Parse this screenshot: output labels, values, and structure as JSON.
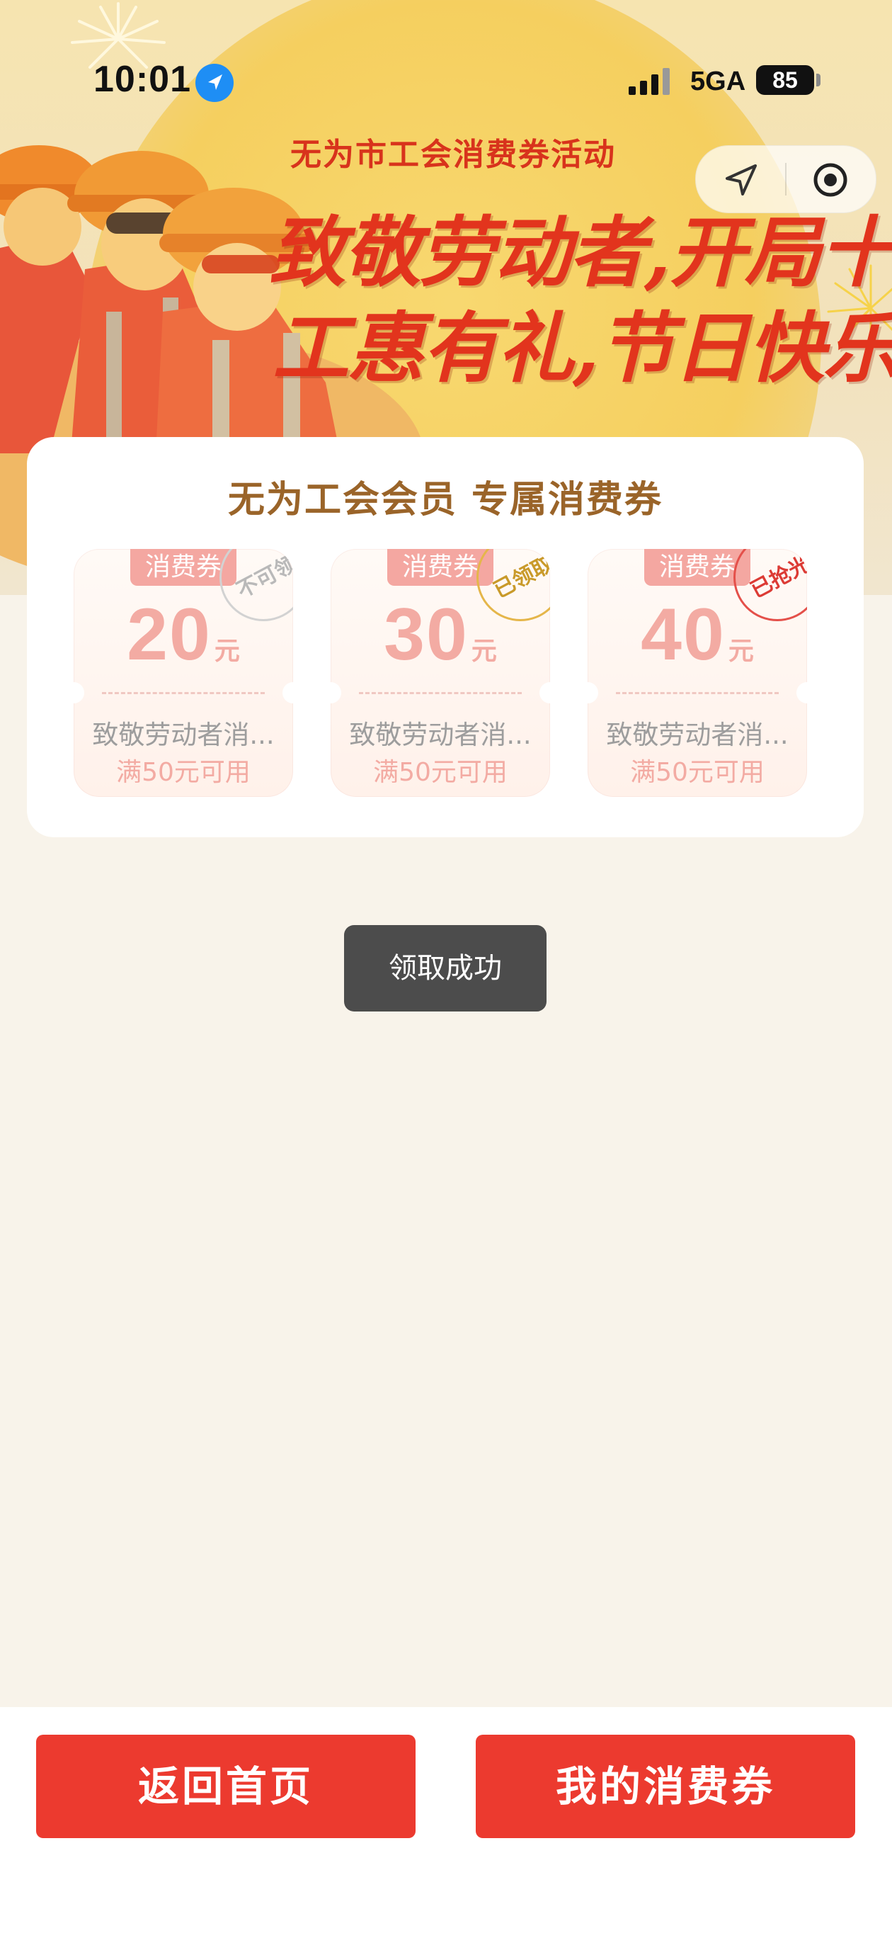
{
  "status_bar": {
    "time": "10:01",
    "network": "5GA",
    "battery": "85"
  },
  "banner": {
    "event_title": "无为市工会消费券活动",
    "slogan_line1": "致敬劳动者,开局十五五",
    "slogan_line2": "工惠有礼,节日快乐"
  },
  "card": {
    "title": "无为工会会员 专属消费券",
    "coupons": [
      {
        "tag": "消费券",
        "amount": "20",
        "unit": "元",
        "name": "致敬劳动者消...",
        "condition": "满50元可用",
        "status": "不可领",
        "status_color": "#b9b9b9"
      },
      {
        "tag": "消费券",
        "amount": "30",
        "unit": "元",
        "name": "致敬劳动者消...",
        "condition": "满50元可用",
        "status": "已领取",
        "status_color": "#c99a2a"
      },
      {
        "tag": "消费券",
        "amount": "40",
        "unit": "元",
        "name": "致敬劳动者消...",
        "condition": "满50元可用",
        "status": "已抢光",
        "status_color": "#dc3b35"
      }
    ]
  },
  "toast": "领取成功",
  "footer": {
    "home_button": "返回首页",
    "my_coupons_button": "我的消费券"
  },
  "colors": {
    "accent": "#ec3a2f",
    "coupon_pink": "#f3aba3",
    "title_brown": "#9a6429",
    "page_bg": "#f8f3ea"
  }
}
